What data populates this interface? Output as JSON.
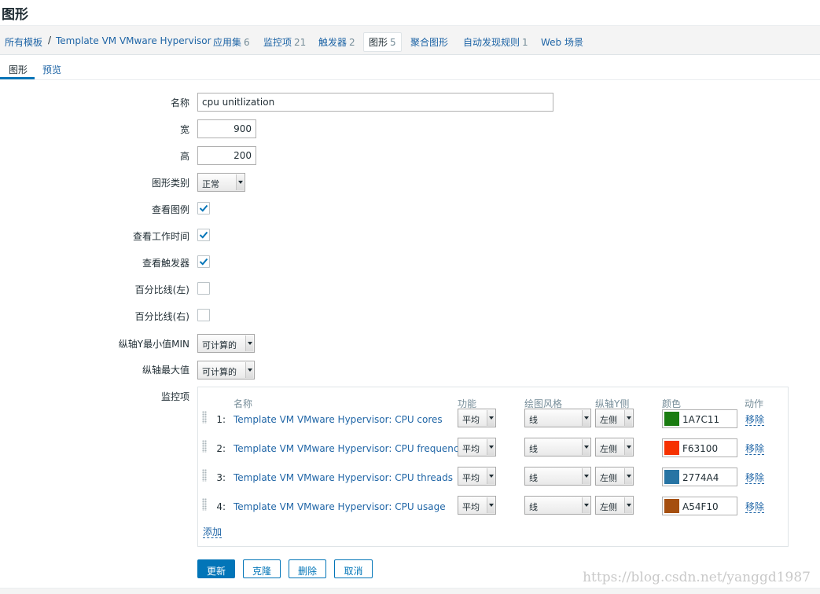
{
  "page": {
    "title": "图形"
  },
  "breadcrumb": {
    "all_templates": "所有模板",
    "separator": "/",
    "template": "Template VM VMware Hypervisor",
    "applications": {
      "label": "应用集",
      "count": "6"
    },
    "items": {
      "label": "监控项",
      "count": "21"
    },
    "triggers": {
      "label": "触发器",
      "count": "2"
    },
    "graphs": {
      "label": "图形",
      "count": "5"
    },
    "screens": {
      "label": "聚合图形"
    },
    "discovery": {
      "label": "自动发现规则",
      "count": "1"
    },
    "web": {
      "label": "Web 场景"
    }
  },
  "tabs": {
    "graph": "图形",
    "preview": "预览"
  },
  "form": {
    "name": {
      "label": "名称",
      "value": "cpu unitlization"
    },
    "width": {
      "label": "宽",
      "value": "900"
    },
    "height": {
      "label": "高",
      "value": "200"
    },
    "graph_type": {
      "label": "图形类别",
      "value": "正常"
    },
    "show_legend": {
      "label": "查看图例",
      "checked": true
    },
    "show_work_period": {
      "label": "查看工作时间",
      "checked": true
    },
    "show_triggers": {
      "label": "查看触发器",
      "checked": true
    },
    "percentile_left": {
      "label": "百分比线(左)",
      "checked": false
    },
    "percentile_right": {
      "label": "百分比线(右)",
      "checked": false
    },
    "y_min": {
      "label": "纵轴Y最小值MIN",
      "value": "可计算的"
    },
    "y_max": {
      "label": "纵轴最大值",
      "value": "可计算的"
    },
    "items_label": "监控项"
  },
  "items_table": {
    "headers": {
      "name": "名称",
      "function": "功能",
      "draw_style": "绘图风格",
      "y_axis_side": "纵轴Y侧",
      "color": "颜色",
      "action": "动作"
    },
    "rows": [
      {
        "num": "1:",
        "name": "Template VM VMware Hypervisor: CPU cores",
        "function": "平均",
        "draw_style": "线",
        "y_axis_side": "左侧",
        "color": "1A7C11",
        "swatch": "#1A7C11",
        "action": "移除"
      },
      {
        "num": "2:",
        "name": "Template VM VMware Hypervisor: CPU frequency",
        "function": "平均",
        "draw_style": "线",
        "y_axis_side": "左侧",
        "color": "F63100",
        "swatch": "#F63100",
        "action": "移除"
      },
      {
        "num": "3:",
        "name": "Template VM VMware Hypervisor: CPU threads",
        "function": "平均",
        "draw_style": "线",
        "y_axis_side": "左侧",
        "color": "2774A4",
        "swatch": "#2774A4",
        "action": "移除"
      },
      {
        "num": "4:",
        "name": "Template VM VMware Hypervisor: CPU usage",
        "function": "平均",
        "draw_style": "线",
        "y_axis_side": "左侧",
        "color": "A54F10",
        "swatch": "#A54F10",
        "action": "移除"
      }
    ],
    "add_label": "添加"
  },
  "buttons": {
    "update": "更新",
    "clone": "克隆",
    "delete": "删除",
    "cancel": "取消"
  },
  "watermark": "https://blog.csdn.net/yanggd1987",
  "colors": {
    "accent": "#0275b8",
    "link": "#1f65a6",
    "text": "#1f2c33"
  }
}
